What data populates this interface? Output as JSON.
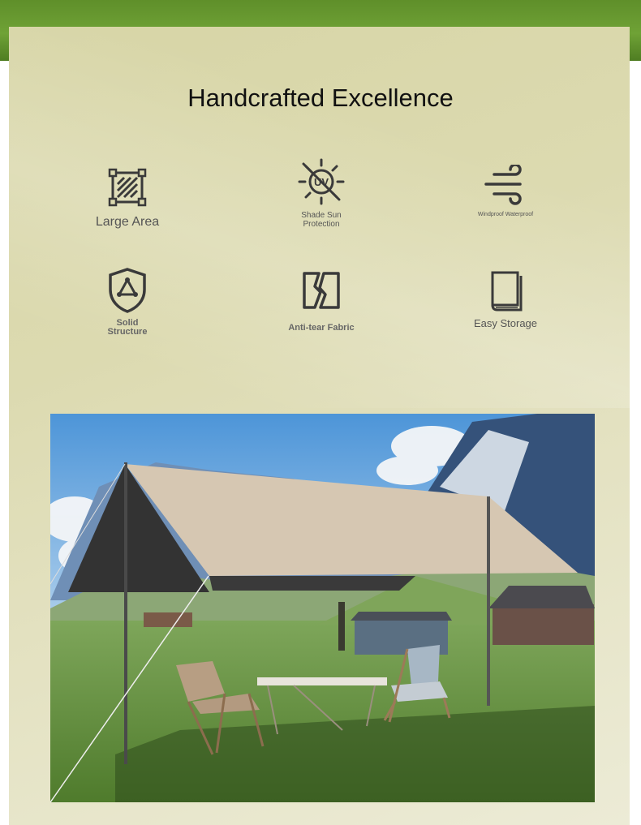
{
  "title": "Handcrafted Excellence",
  "features": [
    {
      "label": "Large Area",
      "icon": "large-area-icon"
    },
    {
      "label": "Shade Sun Protection",
      "icon": "uv-protection-icon"
    },
    {
      "label": "Windproof Waterproof",
      "icon": "wind-icon"
    },
    {
      "label": "Solid Structure",
      "icon": "shield-triangle-icon"
    },
    {
      "label": "Anti-tear Fabric",
      "icon": "torn-fabric-icon"
    },
    {
      "label": "Easy Storage",
      "icon": "book-storage-icon"
    }
  ],
  "colors": {
    "panel": "#dcdab0",
    "icon": "#3a3a3a",
    "tarp": "#d6c7b2",
    "tarp_side": "#333333",
    "grass": "#5e8c3a"
  }
}
